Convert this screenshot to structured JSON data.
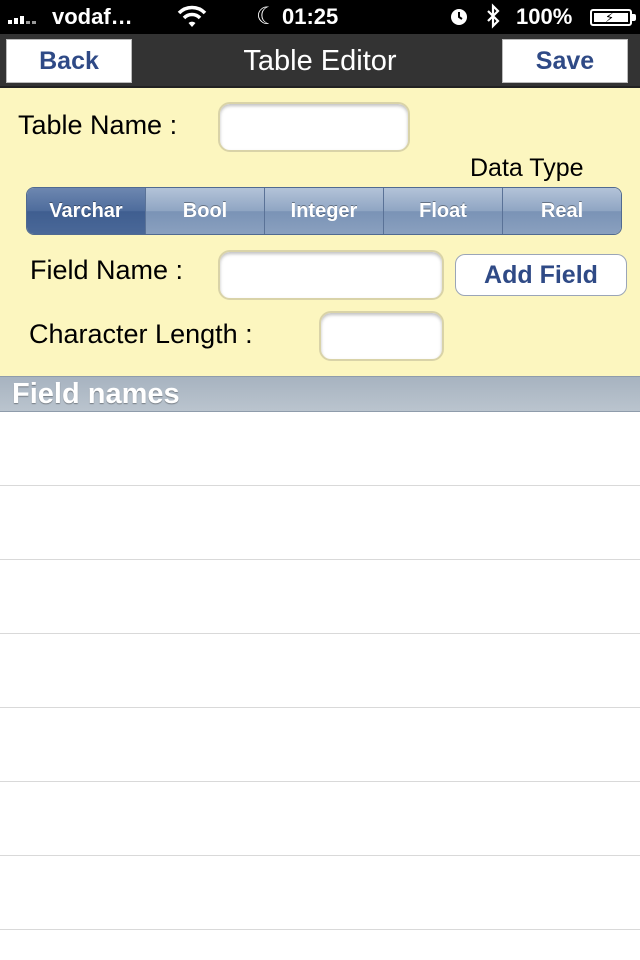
{
  "status_bar": {
    "carrier": "vodaf…",
    "time": "01:25",
    "battery": "100%",
    "icons": [
      "signal-icon",
      "wifi-icon",
      "moon-icon",
      "alarm-icon",
      "bluetooth-icon",
      "battery-icon"
    ]
  },
  "nav": {
    "back_label": "Back",
    "title": "Table Editor",
    "save_label": "Save"
  },
  "form": {
    "table_name_label": "Table Name :",
    "table_name_value": "",
    "data_type_label": "Data Type",
    "data_types": [
      "Varchar",
      "Bool",
      "Integer",
      "Float",
      "Real"
    ],
    "selected_data_type": "Varchar",
    "field_name_label": "Field Name :",
    "field_name_value": "",
    "add_field_label": "Add Field",
    "char_length_label": "Character Length :",
    "char_length_value": ""
  },
  "table": {
    "section_header": "Field names",
    "rows": [
      "",
      "",
      "",
      "",
      "",
      "",
      ""
    ]
  },
  "colors": {
    "form_background": "#fcf6bf",
    "button_text": "#2f4a86",
    "segment_selected": "#4e6c9c",
    "nav_background": "#333333"
  }
}
